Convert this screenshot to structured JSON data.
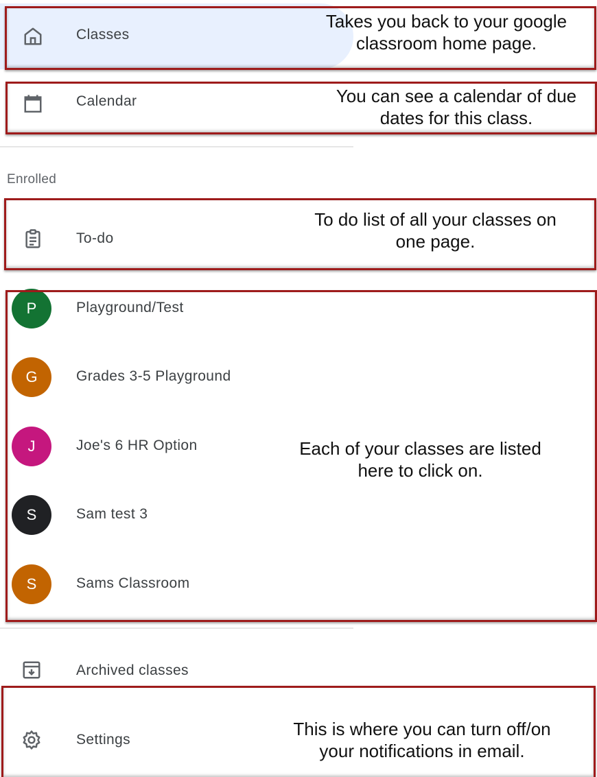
{
  "nav": {
    "classes": {
      "label": "Classes",
      "icon": "home-icon"
    },
    "calendar": {
      "label": "Calendar",
      "icon": "calendar-icon"
    }
  },
  "enrolled": {
    "section_label": "Enrolled",
    "todo": {
      "label": "To-do",
      "icon": "clipboard-icon"
    },
    "classes": [
      {
        "initial": "P",
        "name": "Playground/Test",
        "color": "#137333"
      },
      {
        "initial": "G",
        "name": "Grades 3-5 Playground",
        "color": "#c26401"
      },
      {
        "initial": "J",
        "name": "Joe's 6 HR Option",
        "color": "#c5177e"
      },
      {
        "initial": "S",
        "name": "Sam test 3",
        "color": "#202124"
      },
      {
        "initial": "S",
        "name": "Sams Classroom",
        "color": "#c26401"
      }
    ]
  },
  "footer_nav": {
    "archived": {
      "label": "Archived classes",
      "icon": "archive-icon"
    },
    "settings": {
      "label": "Settings",
      "icon": "gear-icon"
    }
  },
  "annotations": {
    "classes": "Takes you back to your google classroom home page.",
    "calendar": "You can see a calendar of due dates for this class.",
    "todo": "To do list of all your classes on one page.",
    "class_list": "Each of your classes are listed here to click on.",
    "settings": "This is where you can turn off/on your notifications in email."
  },
  "colors": {
    "active_highlight": "#e8f0fe",
    "annotation_border": "#9e1b1b"
  }
}
